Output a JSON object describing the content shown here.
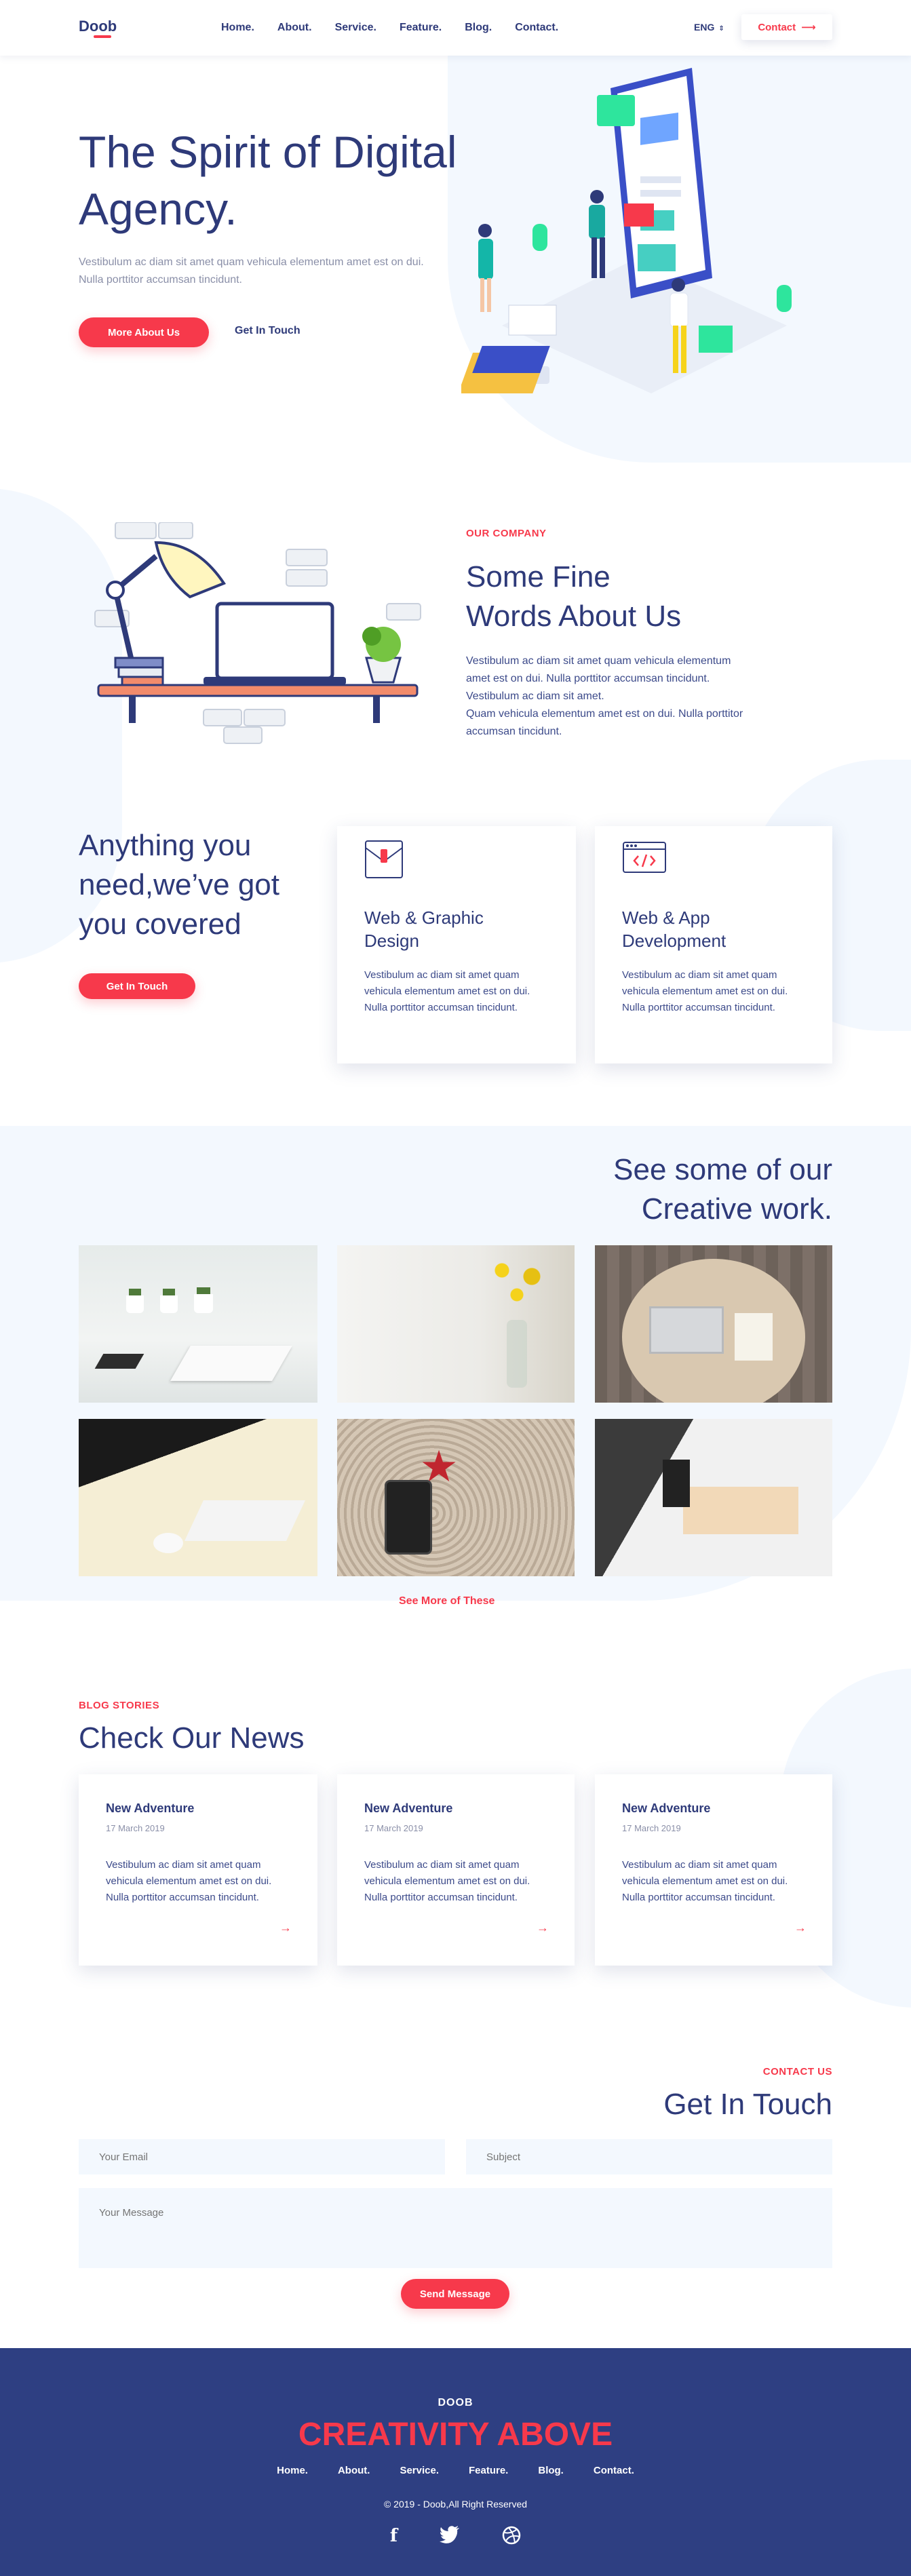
{
  "header": {
    "logo": "Doob",
    "nav": [
      "Home.",
      "About.",
      "Service.",
      "Feature.",
      "Blog.",
      "Contact."
    ],
    "language": "ENG",
    "contact_button": "Contact"
  },
  "hero": {
    "title": "The Spirit of Digital Agency.",
    "text": "Vestibulum ac diam sit amet quam vehicula elementum amet est on dui. Nulla porttitor accumsan tincidunt.",
    "primary_button": "More About Us",
    "secondary_button": "Get In Touch"
  },
  "about": {
    "eyebrow": "OUR COMPANY",
    "title_line1": "Some Fine",
    "title_line2": "Words About Us",
    "text_line1": "Vestibulum ac diam sit amet quam vehicula elementum",
    "text_line2": "amet est on dui. Nulla porttitor accumsan tincidunt.",
    "text_line3": "Vestibulum ac diam sit amet.",
    "text_line4": "Quam vehicula elementum amet est on dui. Nulla porttitor",
    "text_line5": "accumsan tincidunt."
  },
  "services": {
    "title_line1": "Anything you",
    "title_line2": "need,we’ve got",
    "title_line3": "you covered",
    "button": "Get In Touch",
    "cards": [
      {
        "icon": "envelope-icon",
        "title_line1": "Web & Graphic",
        "title_line2": "Design",
        "text": "Vestibulum ac diam sit amet quam vehicula elementum amet est on dui. Nulla porttitor accumsan tincidunt."
      },
      {
        "icon": "code-window-icon",
        "title_line1": "Web & App",
        "title_line2": "Development",
        "text": "Vestibulum ac diam sit amet quam vehicula elementum amet est on dui. Nulla porttitor accumsan tincidunt."
      }
    ]
  },
  "portfolio": {
    "title_line1": "See some of our",
    "title_line2": "Creative work.",
    "see_more": "See More of These"
  },
  "blog": {
    "eyebrow": "BLOG STORIES",
    "title": "Check Our News",
    "posts": [
      {
        "title": "New Adventure",
        "date": "17 March 2019",
        "text": "Vestibulum ac diam sit amet quam vehicula elementum amet est on dui. Nulla porttitor accumsan tincidunt.",
        "arrow": "→"
      },
      {
        "title": "New Adventure",
        "date": "17 March 2019",
        "text": "Vestibulum ac diam sit amet quam vehicula elementum amet est on dui. Nulla porttitor accumsan tincidunt.",
        "arrow": "→"
      },
      {
        "title": "New Adventure",
        "date": "17 March 2019",
        "text": "Vestibulum ac diam sit amet quam vehicula elementum amet est on dui. Nulla porttitor accumsan tincidunt.",
        "arrow": "→"
      }
    ]
  },
  "contact": {
    "eyebrow": "CONTACT US",
    "title": "Get In Touch",
    "email_placeholder": "Your Email",
    "subject_placeholder": "Subject",
    "message_placeholder": "Your Message",
    "button": "Send Message"
  },
  "footer": {
    "brand": "DOOB",
    "tagline": "CREATIVITY ABOVE",
    "nav": [
      "Home.",
      "About.",
      "Service.",
      "Feature.",
      "Blog.",
      "Contact."
    ],
    "copyright": "© 2019 - Doob,All Right Reserved",
    "social": [
      "facebook-icon",
      "twitter-icon",
      "dribbble-icon"
    ]
  },
  "colors": {
    "primary": "#2e3a79",
    "accent": "#f7394b",
    "light_bg": "#f3f8fe",
    "footer_bg": "#2e3f82"
  }
}
